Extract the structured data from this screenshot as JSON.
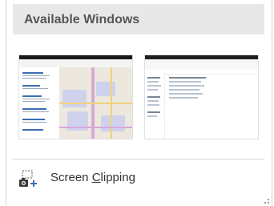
{
  "header": {
    "title": "Available Windows"
  },
  "windows": [
    {
      "icon": "browser-map-thumbnail"
    },
    {
      "icon": "file-explorer-thumbnail"
    }
  ],
  "clipping": {
    "label_before": "Screen ",
    "label_access_key": "C",
    "label_after": "lipping",
    "icon": "screen-clipping-icon"
  },
  "colors": {
    "header_bg": "#e8e8e8",
    "header_text": "#555555",
    "accent": "#3a6fb0"
  }
}
